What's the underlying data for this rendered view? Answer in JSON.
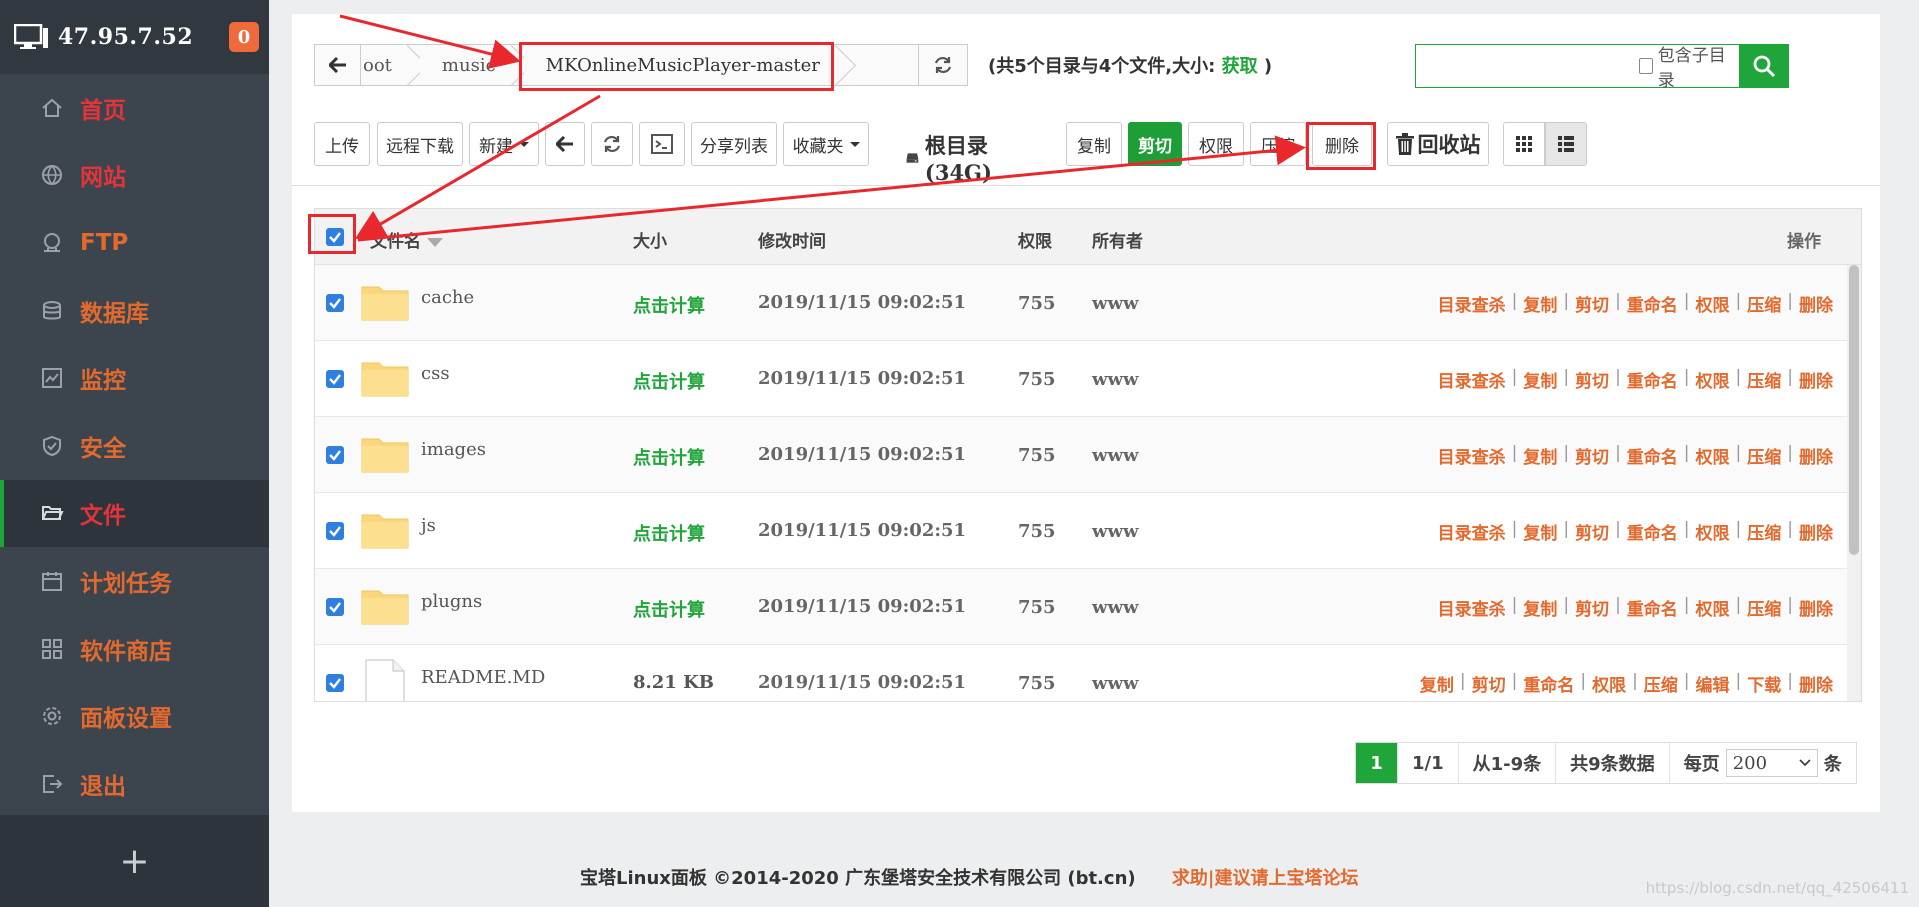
{
  "sidebar": {
    "ip": "47.95.7.52",
    "badge": "0",
    "items": [
      {
        "label": "首页",
        "icon": "home-icon",
        "color": "red"
      },
      {
        "label": "网站",
        "icon": "globe-icon",
        "color": "red"
      },
      {
        "label": "FTP",
        "icon": "ftp-icon",
        "color": "orange"
      },
      {
        "label": "数据库",
        "icon": "database-icon",
        "color": "orange"
      },
      {
        "label": "监控",
        "icon": "monitor-chart-icon",
        "color": "orange"
      },
      {
        "label": "安全",
        "icon": "shield-icon",
        "color": "orange"
      },
      {
        "label": "文件",
        "icon": "folder-open-icon",
        "color": "red",
        "active": true
      },
      {
        "label": "计划任务",
        "icon": "calendar-icon",
        "color": "orange"
      },
      {
        "label": "软件商店",
        "icon": "apps-grid-icon",
        "color": "orange"
      },
      {
        "label": "面板设置",
        "icon": "gear-icon",
        "color": "orange"
      },
      {
        "label": "退出",
        "icon": "logout-icon",
        "color": "orange"
      }
    ],
    "add_label": "+"
  },
  "breadcrumb": {
    "items": [
      "oot",
      "music",
      "MKOnlineMusicPlayer-master"
    ]
  },
  "summary": {
    "prefix": "(共5个目录与4个文件,大小:",
    "get_link": "获取",
    "suffix": ")"
  },
  "search": {
    "placeholder": "",
    "subdir_label": "包含子目录"
  },
  "toolbar": {
    "upload": "上传",
    "remote_download": "远程下载",
    "new": "新建",
    "share_list": "分享列表",
    "favorites": "收藏夹",
    "root_dir": "根目录(34G)",
    "copy": "复制",
    "cut": "剪切",
    "permission": "权限",
    "compress": "压缩",
    "delete": "删除",
    "recycle": "回收站"
  },
  "table": {
    "headers": {
      "name": "文件名",
      "size": "大小",
      "mtime": "修改时间",
      "perm": "权限",
      "owner": "所有者",
      "ops": "操作"
    },
    "rows": [
      {
        "name": "cache",
        "type": "folder",
        "size": "点击计算",
        "mtime": "2019/11/15 09:02:51",
        "perm": "755",
        "owner": "www",
        "ops": [
          "目录查杀",
          "复制",
          "剪切",
          "重命名",
          "权限",
          "压缩",
          "删除"
        ]
      },
      {
        "name": "css",
        "type": "folder",
        "size": "点击计算",
        "mtime": "2019/11/15 09:02:51",
        "perm": "755",
        "owner": "www",
        "ops": [
          "目录查杀",
          "复制",
          "剪切",
          "重命名",
          "权限",
          "压缩",
          "删除"
        ]
      },
      {
        "name": "images",
        "type": "folder",
        "size": "点击计算",
        "mtime": "2019/11/15 09:02:51",
        "perm": "755",
        "owner": "www",
        "ops": [
          "目录查杀",
          "复制",
          "剪切",
          "重命名",
          "权限",
          "压缩",
          "删除"
        ]
      },
      {
        "name": "js",
        "type": "folder",
        "size": "点击计算",
        "mtime": "2019/11/15 09:02:51",
        "perm": "755",
        "owner": "www",
        "ops": [
          "目录查杀",
          "复制",
          "剪切",
          "重命名",
          "权限",
          "压缩",
          "删除"
        ]
      },
      {
        "name": "plugns",
        "type": "folder",
        "size": "点击计算",
        "mtime": "2019/11/15 09:02:51",
        "perm": "755",
        "owner": "www",
        "ops": [
          "目录查杀",
          "复制",
          "剪切",
          "重命名",
          "权限",
          "压缩",
          "删除"
        ]
      },
      {
        "name": "README.MD",
        "type": "file",
        "size": "8.21 KB",
        "mtime": "2019/11/15 09:02:51",
        "perm": "755",
        "owner": "www",
        "ops": [
          "复制",
          "剪切",
          "重命名",
          "权限",
          "压缩",
          "编辑",
          "下载",
          "删除"
        ]
      }
    ]
  },
  "pager": {
    "current": "1",
    "pages": "1/1",
    "range": "从1-9条",
    "total": "共9条数据",
    "per_page_label": "每页",
    "per_page_value": "200",
    "unit": "条"
  },
  "footer": {
    "copyright": "宝塔Linux面板 ©2014-2020 广东堡塔安全技术有限公司 (bt.cn)",
    "help": "求助|建议请上宝塔论坛"
  },
  "watermark": "https://blog.csdn.net/qq_42506411",
  "colors": {
    "green": "#20a53a",
    "orange": "#e36a2e",
    "red": "#e3343a",
    "sidebar": "#3c444d",
    "annotation": "#e8282d"
  }
}
